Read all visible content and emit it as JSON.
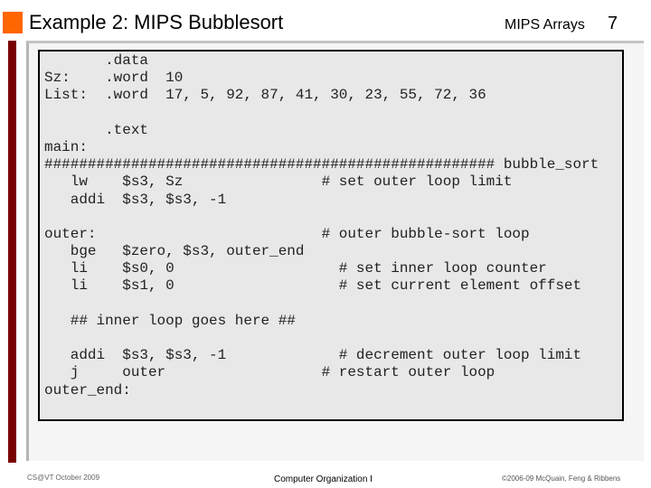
{
  "header": {
    "title": "Example 2: MIPS Bubblesort",
    "section": "MIPS Arrays",
    "page_number": "7",
    "accent_color": "#ff6600",
    "bar_color": "#7a0000"
  },
  "code": {
    "lines": [
      "       .data",
      "Sz:    .word  10",
      "List:  .word  17, 5, 92, 87, 41, 30, 23, 55, 72, 36",
      "",
      "       .text",
      "main:",
      "#################################################### bubble_sort",
      "   lw    $s3, Sz                # set outer loop limit",
      "   addi  $s3, $s3, -1",
      "",
      "outer:                          # outer bubble-sort loop",
      "   bge   $zero, $s3, outer_end",
      "   li    $s0, 0                   # set inner loop counter",
      "   li    $s1, 0                   # set current element offset",
      "",
      "   ## inner loop goes here ##",
      "",
      "   addi  $s3, $s3, -1             # decrement outer loop limit",
      "   j     outer                  # restart outer loop",
      "outer_end:"
    ]
  },
  "footer": {
    "left": "CS@VT October 2009",
    "center": "Computer Organization I",
    "right": "©2006-09  McQuain, Feng & Ribbens"
  }
}
